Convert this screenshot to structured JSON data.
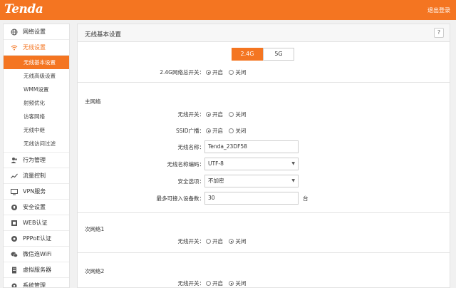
{
  "header": {
    "logo": "Tenda",
    "logout": "退出登录"
  },
  "sidebar": {
    "items": [
      {
        "label": "网络设置",
        "icon": "globe-icon"
      },
      {
        "label": "无线设置",
        "icon": "wifi-icon"
      },
      {
        "label": "行为管理",
        "icon": "users-icon"
      },
      {
        "label": "流量控制",
        "icon": "chart-icon"
      },
      {
        "label": "VPN服务",
        "icon": "vpn-icon"
      },
      {
        "label": "安全设置",
        "icon": "shield-icon"
      },
      {
        "label": "WEB认证",
        "icon": "web-auth-icon"
      },
      {
        "label": "PPPoE认证",
        "icon": "pppoe-icon"
      },
      {
        "label": "微信连WiFi",
        "icon": "wechat-icon"
      },
      {
        "label": "虚拟服务器",
        "icon": "server-icon"
      },
      {
        "label": "系统管理",
        "icon": "gear-icon"
      }
    ],
    "submenu": [
      "无线基本设置",
      "无线高级设置",
      "WMM设置",
      "射频优化",
      "访客网络",
      "无线中继",
      "无线访问过滤"
    ]
  },
  "main": {
    "title": "无线基本设置",
    "help": "?",
    "tabs": [
      "2.4G",
      "5G"
    ],
    "master_switch_label": "2.4G网络总开关：",
    "on": "开启",
    "off": "关闭",
    "primary": {
      "title": "主网络",
      "wireless_switch_label": "无线开关：",
      "ssid_broadcast_label": "SSID广播：",
      "ssid_label": "无线名称：",
      "ssid_value": "Tenda_23DF58",
      "encoding_label": "无线名称编码：",
      "encoding_value": "UTF-8",
      "security_label": "安全选项：",
      "security_value": "不加密",
      "max_devices_label": "最多可接入设备数：",
      "max_devices_value": "30",
      "max_devices_unit": "台"
    },
    "secondary1": {
      "title": "次网络1",
      "wireless_switch_label": "无线开关："
    },
    "secondary2": {
      "title": "次网络2",
      "wireless_switch_label": "无线开关："
    }
  },
  "colors": {
    "accent": "#f47521"
  }
}
